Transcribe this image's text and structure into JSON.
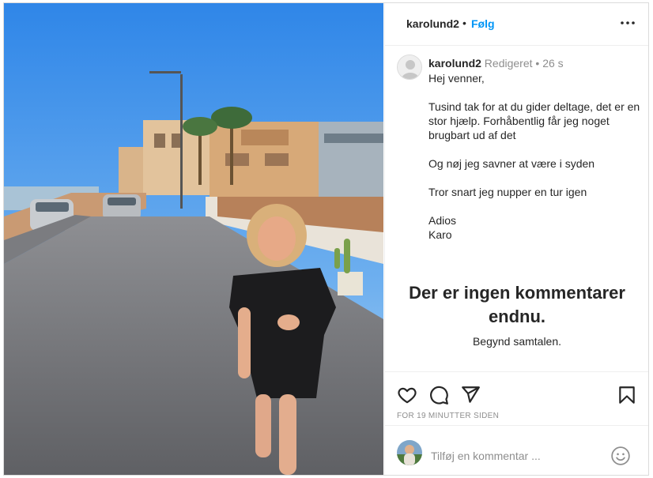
{
  "post": {
    "username": "karolund2",
    "follow_label": "Følg",
    "separator": "•"
  },
  "caption": {
    "username": "karolund2",
    "edited": "Redigeret",
    "meta_sep": "•",
    "age": "26 s",
    "lines": [
      "Hej venner,",
      "",
      "Tusind tak for at du gider deltage, det er en stor hjælp. Forhåbentlig får jeg noget brugbart ud af det",
      "",
      "Og nøj jeg savner at være i syden",
      "",
      "Tror snart jeg nupper en tur igen",
      "",
      "Adios",
      "Karo"
    ]
  },
  "comments": {
    "empty_title": "Der er ingen kommentarer endnu.",
    "empty_subtitle": "Begynd samtalen."
  },
  "actions": {
    "icons": [
      "heart-icon",
      "comment-icon",
      "share-icon",
      "bookmark-icon"
    ],
    "timestamp": "FOR 19 MINUTTER SIDEN"
  },
  "add_comment": {
    "placeholder": "Tilføj en kommentar ...",
    "emoji_icon": "smiley-icon"
  },
  "colors": {
    "link": "#0095f6",
    "muted": "#8e8e8e",
    "border": "#dbdbdb"
  }
}
